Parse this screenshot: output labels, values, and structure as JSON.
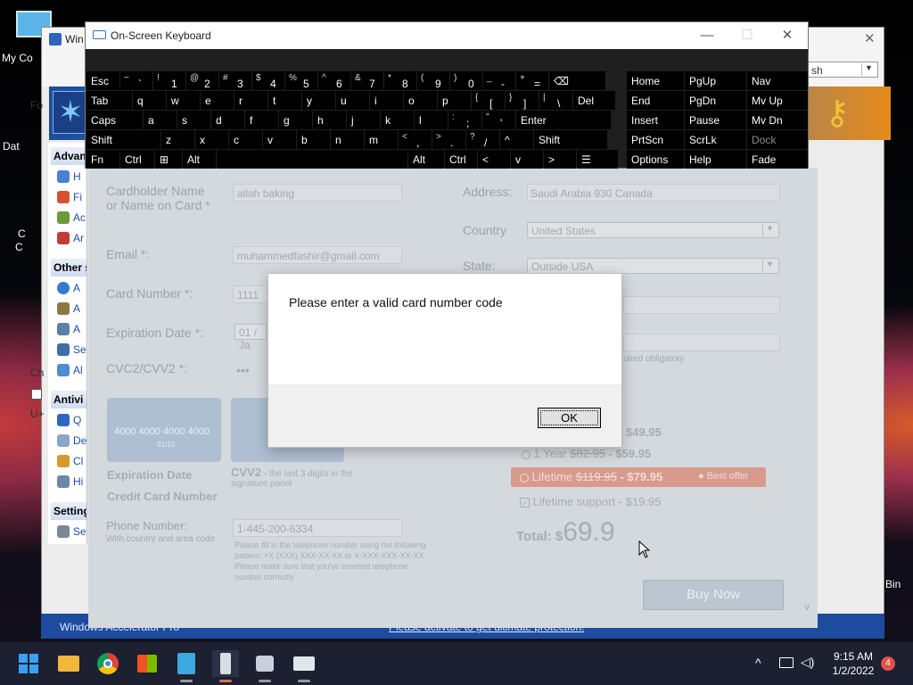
{
  "desktop": {
    "icon_labels": [
      "My Co",
      "Dat",
      "C",
      "C",
      "Bin"
    ],
    "back_window_title": "Win"
  },
  "back_window": {
    "language_select": "sh",
    "left_labels": [
      "Fo"
    ],
    "sections": [
      "Advan",
      "Other s",
      "Antivi",
      "Setting"
    ],
    "items": [
      "H",
      "Fi",
      "Ac",
      "Ar",
      "A",
      "A",
      "A",
      "Se",
      "Al",
      "Q",
      "De",
      "Cl",
      "Hi",
      "Se"
    ],
    "side_text": [
      "Ch",
      "U+"
    ],
    "status_left": "Windows Accelerator Pro",
    "status_link": "Please activate to get ultimate protection!"
  },
  "form": {
    "name_label": "Cardholder Name or Name on Card *",
    "name_value": "allah baking",
    "email_label": "Email *:",
    "email_value": "muhammedfashir@gmail.com",
    "card_label": "Card Number *:",
    "card_value": "1111",
    "exp_label": "Expiration Date *:",
    "exp_value": "01 / Ja",
    "cvc_label": "CVC2/CVV2 *:",
    "cvc_value": "•••",
    "address_label": "Address:",
    "address_value": "Saudi Arabia 930 Canada",
    "country_label": "Country",
    "country_value": "United States",
    "state_label": "State:",
    "state_value": "Outside USA",
    "required_note": "uired obligatory",
    "card_image_number": "4000 4000 4000 4000",
    "card_image_date": "01/15",
    "exp_caption": "Expiration Date",
    "cc_caption": "Credit Card Number",
    "cvv_caption": "CVV2",
    "cvv_desc": "- the last 3 digits in the signature panel",
    "phone_label": "Phone Number:",
    "phone_sub": "With country and area code",
    "phone_value": "1-445-200-6334",
    "phone_help": "Please fill in the telephone number using the following pattern: +X (XXX) XXX-XX-XX or X-XXX-XXX-XX-XX Please make sure that you've inserted telephone number correctly",
    "price_6m": "- $49.95",
    "price_1y_label": "1 Year",
    "price_1y_old": "$82.95",
    "price_1y_new": "- $59.95",
    "price_life_label": "Lifetime",
    "price_life_old": "$119.95",
    "price_life_new": "- $79.95",
    "best_offer": "Best offer",
    "support_label": "Lifetime support - $19.95",
    "total_label": "Total: $",
    "total_value": "69.9",
    "buy_button": "Buy Now"
  },
  "dialog": {
    "message": "Please enter a valid card number code",
    "ok_label": "OK"
  },
  "osk": {
    "title": "On-Screen Keyboard",
    "window_buttons": [
      "—",
      "☐",
      "✕"
    ],
    "row1": [
      [
        "Esc",
        ""
      ],
      [
        "~",
        "`"
      ],
      [
        "!",
        "1"
      ],
      [
        "@",
        "2"
      ],
      [
        "#",
        "3"
      ],
      [
        "$",
        "4"
      ],
      [
        "%",
        "5"
      ],
      [
        "^",
        "6"
      ],
      [
        "&",
        "7"
      ],
      [
        "*",
        "8"
      ],
      [
        "(",
        "9"
      ],
      [
        ")",
        "0"
      ],
      [
        "_",
        "-"
      ],
      [
        "+",
        "="
      ],
      [
        "⌫",
        ""
      ]
    ],
    "row2": [
      "Tab",
      "q",
      "w",
      "e",
      "r",
      "t",
      "y",
      "u",
      "i",
      "o",
      "p",
      "[",
      "]",
      "\\",
      "Del"
    ],
    "row2_top": [
      "",
      "",
      "",
      "",
      "",
      "",
      "",
      "",
      "",
      "",
      "",
      "{",
      "}",
      "|",
      ""
    ],
    "row3": [
      "Caps",
      "a",
      "s",
      "d",
      "f",
      "g",
      "h",
      "j",
      "k",
      "l",
      ";",
      "'",
      "Enter"
    ],
    "row3_top": [
      "",
      "",
      "",
      "",
      "",
      "",
      "",
      "",
      "",
      "",
      ":",
      "\"",
      ""
    ],
    "row4": [
      "Shift",
      "z",
      "x",
      "c",
      "v",
      "b",
      "n",
      "m",
      ",",
      ".",
      "/",
      "^",
      "Shift"
    ],
    "row4_top": [
      "",
      "",
      "",
      "",
      "",
      "",
      "",
      "",
      "<",
      ">",
      "?",
      "",
      ""
    ],
    "row5": [
      "Fn",
      "Ctrl",
      "⊞",
      "Alt",
      "",
      "Alt",
      "Ctrl",
      "<",
      "v",
      ">",
      "☰"
    ],
    "nav": [
      [
        "Home",
        "PgUp",
        "Nav"
      ],
      [
        "End",
        "PgDn",
        "Mv Up"
      ],
      [
        "Insert",
        "Pause",
        "Mv Dn"
      ],
      [
        "PrtScn",
        "ScrLk",
        "Dock"
      ],
      [
        "Options",
        "Help",
        "Fade"
      ]
    ]
  },
  "taskbar": {
    "time": "9:15 AM",
    "date": "1/2/2022",
    "notifications": "4",
    "tray_chevron": "^"
  },
  "colors": {
    "accent_blue": "#1d4c9e",
    "osk_key": "#000000",
    "best_offer": "#d9694f"
  }
}
